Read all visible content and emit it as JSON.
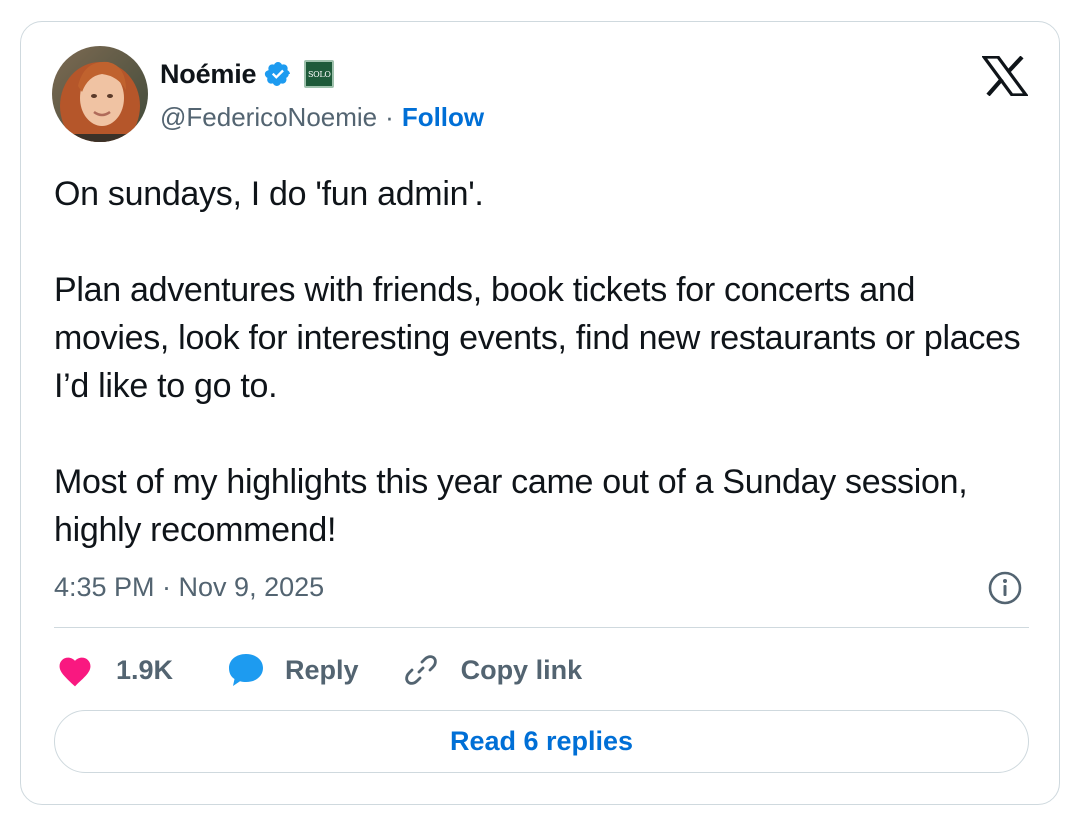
{
  "author": {
    "display_name": "Noémie",
    "handle": "@FedericoNoemie",
    "separator": "·",
    "follow_label": "Follow",
    "verified_icon": "verified-badge-icon",
    "affiliate_badge_text": "SOLO",
    "avatar": "profile-photo"
  },
  "brand": {
    "logo": "x-logo-icon"
  },
  "tweet": {
    "paragraphs": [
      "On sundays, I do 'fun admin'.",
      "Plan adventures with friends, book tickets for concerts and movies, look for interesting events, find new restaurants or places I’d like to go to.",
      "Most of my highlights this year came out of a Sunday session, highly recommend!"
    ],
    "timestamp": "4:35 PM · Nov 9, 2025",
    "info_icon": "info-icon"
  },
  "actions": {
    "like_count": "1.9K",
    "like_icon": "heart-icon",
    "reply_label": "Reply",
    "reply_icon": "speech-bubble-icon",
    "copy_label": "Copy link",
    "copy_icon": "link-icon"
  },
  "footer": {
    "read_replies_label": "Read 6 replies"
  },
  "colors": {
    "text_primary": "#0f1419",
    "text_secondary": "#536471",
    "link_blue": "#006fd6",
    "verified_blue": "#1d9bf0",
    "heart_pink": "#f91880",
    "reply_blue": "#1d9bf0",
    "border": "#cfd9de",
    "badge_green": "#1e5b3a"
  }
}
